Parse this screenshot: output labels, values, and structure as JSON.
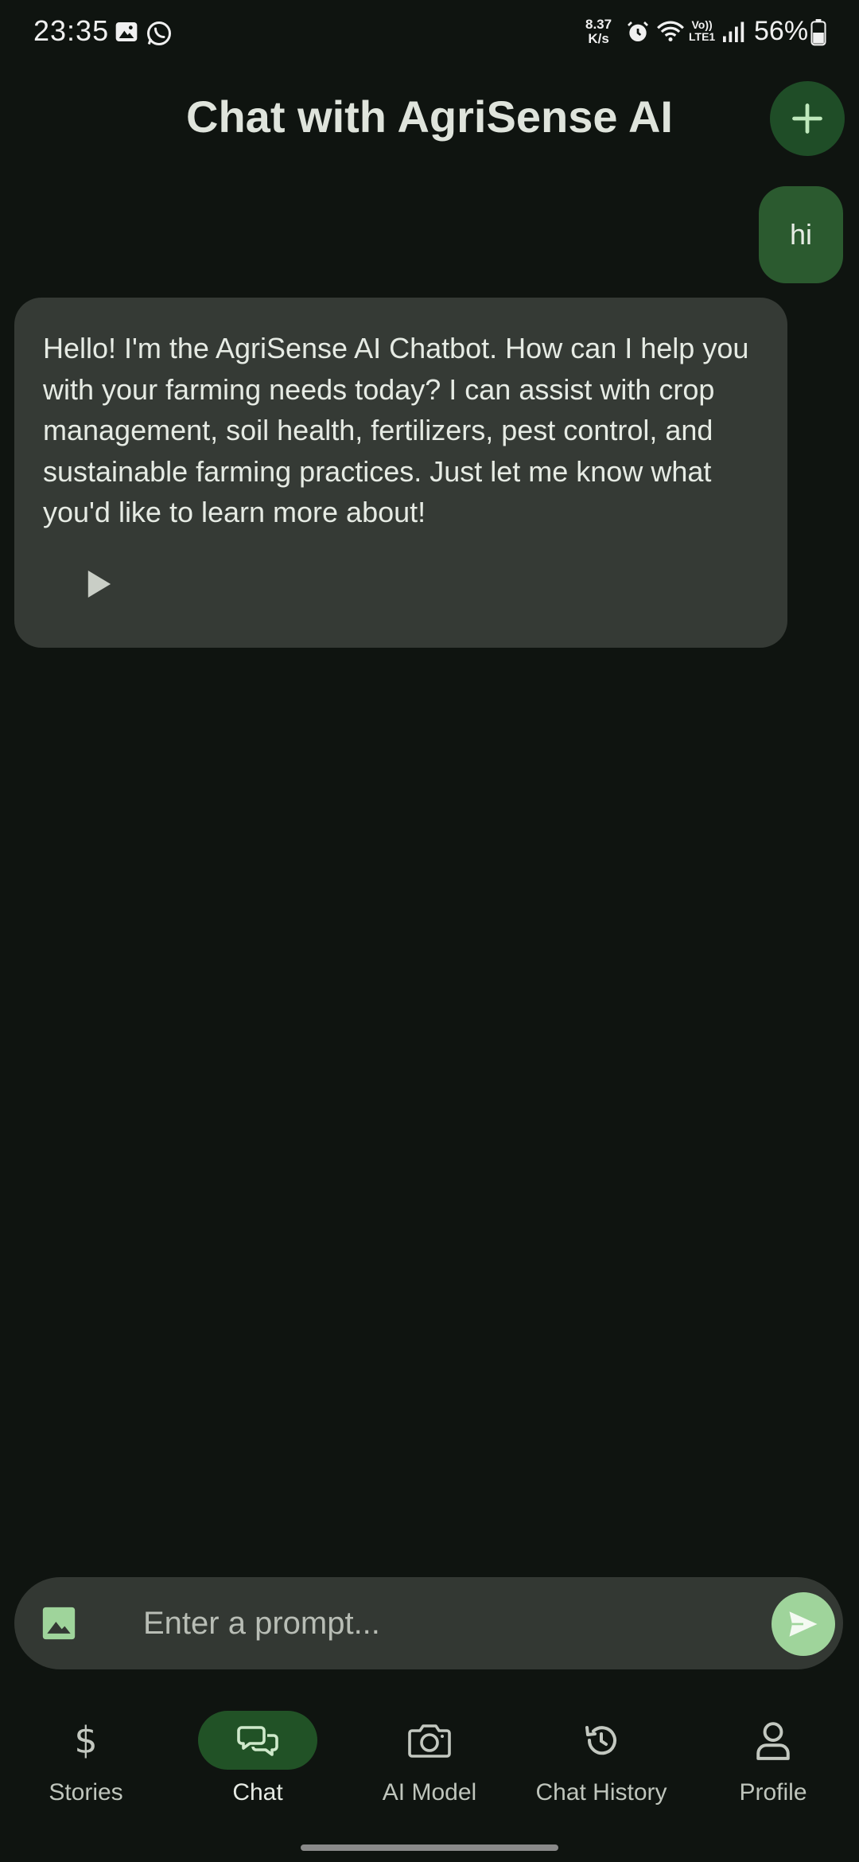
{
  "status_bar": {
    "time": "23:35",
    "speed_value": "8.37",
    "speed_unit": "K/s",
    "network": "LTE1",
    "battery": "56%"
  },
  "header": {
    "title": "Chat with AgriSense AI",
    "new_chat_icon": "plus-icon"
  },
  "messages": [
    {
      "role": "user",
      "text": "hi"
    },
    {
      "role": "bot",
      "text": "Hello! I'm the AgriSense AI Chatbot. How can I help you with your farming needs today? I can assist with crop management, soil health, fertilizers, pest control, and sustainable farming practices. Just let me know what you'd like to learn more about!"
    }
  ],
  "input": {
    "placeholder": "Enter a prompt...",
    "value": ""
  },
  "nav": {
    "items": [
      {
        "label": "Stories",
        "icon": "dollar-icon",
        "active": false
      },
      {
        "label": "Chat",
        "icon": "chat-bubbles-icon",
        "active": true
      },
      {
        "label": "AI Model",
        "icon": "camera-icon",
        "active": false
      },
      {
        "label": "Chat History",
        "icon": "history-icon",
        "active": false
      },
      {
        "label": "Profile",
        "icon": "person-icon",
        "active": false
      }
    ]
  },
  "colors": {
    "background": "#0f1410",
    "accent": "#1f4d27",
    "user_bubble": "#2b5a2f",
    "bot_bubble": "#353a35",
    "send_button": "#9fd49b"
  }
}
